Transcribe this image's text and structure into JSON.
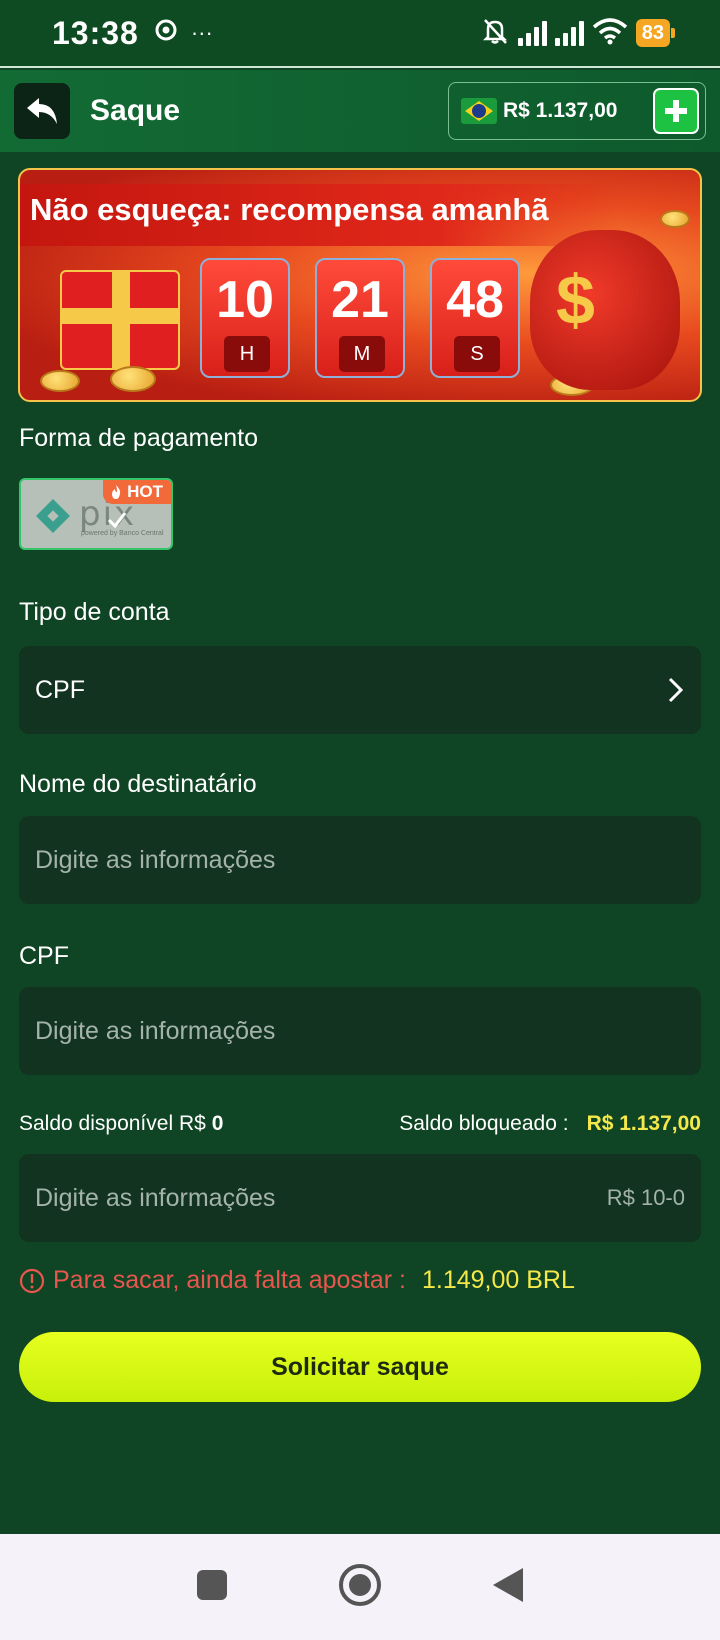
{
  "status_bar": {
    "time": "13:38",
    "battery": "83",
    "more_dots": "···"
  },
  "header": {
    "title": "Saque",
    "balance": "R$ 1.137,00"
  },
  "banner": {
    "title": "Não esqueça: recompensa amanhã",
    "dollar_sign": "$",
    "timer": [
      {
        "value": "10",
        "unit": "H"
      },
      {
        "value": "21",
        "unit": "M"
      },
      {
        "value": "48",
        "unit": "S"
      }
    ]
  },
  "payment": {
    "label": "Forma de pagamento",
    "method_logo_text": "pix",
    "method_sub": "powered by Banco Central",
    "hot_badge": "HOT"
  },
  "account_type": {
    "label": "Tipo de conta",
    "value": "CPF"
  },
  "recipient": {
    "label": "Nome do destinatário",
    "placeholder": "Digite as informações"
  },
  "cpf": {
    "label": "CPF",
    "placeholder": "Digite as informações"
  },
  "balances": {
    "available_label": "Saldo disponível R$",
    "available_value": "0",
    "blocked_label": "Saldo bloqueado :",
    "blocked_value": "R$ 1.137,00"
  },
  "amount": {
    "placeholder": "Digite as informações",
    "range_hint": "R$ 10-0"
  },
  "warning": {
    "text": "Para sacar, ainda falta apostar :",
    "amount": "1.149,00 BRL"
  },
  "submit": {
    "label": "Solicitar saque"
  },
  "colors": {
    "background": "#0f4524",
    "header": "#136b34",
    "field": "#11331f",
    "accent_yellow": "#f4e84a",
    "button": "#e7ff1f",
    "warning": "#e8564e"
  }
}
